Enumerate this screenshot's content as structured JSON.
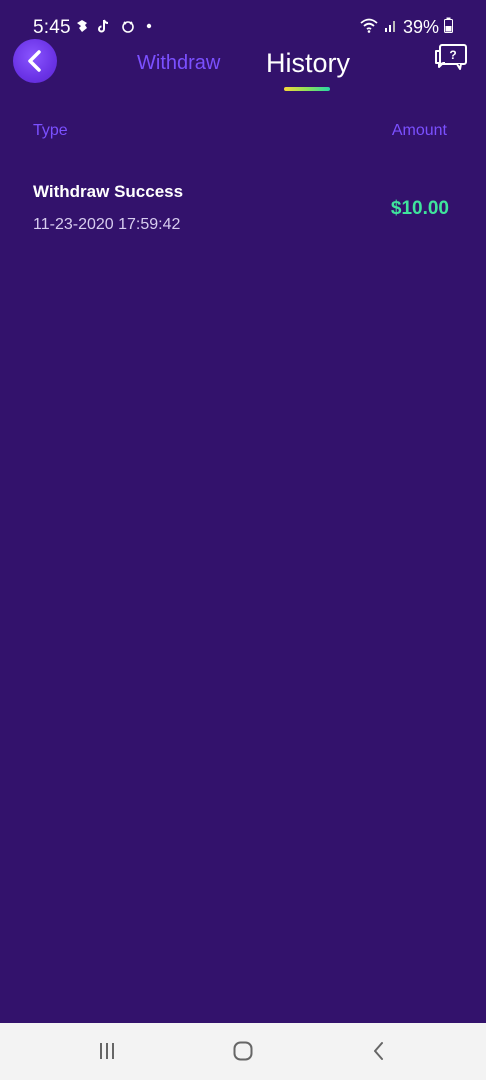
{
  "status_bar": {
    "time": "5:45",
    "battery": "39%",
    "notification_icons": [
      "messenger-icon",
      "tiktok-icon",
      "app-icon",
      "dot-icon"
    ]
  },
  "header": {
    "back_icon": "chevron-left-icon",
    "tabs": [
      {
        "label": "Withdraw",
        "active": false
      },
      {
        "label": "History",
        "active": true
      }
    ],
    "help_icon": "help-chat-icon"
  },
  "table": {
    "columns": {
      "type": "Type",
      "amount": "Amount"
    },
    "rows": [
      {
        "title": "Withdraw Success",
        "date": "11-23-2020 17:59:42",
        "amount": "$10.00"
      }
    ]
  },
  "nav_bar": {
    "buttons": [
      "recent-apps-icon",
      "home-icon",
      "back-icon"
    ]
  },
  "colors": {
    "background": "#33126c",
    "accent": "#7b50ff",
    "amount_green": "#3fe49c",
    "tab_active": "#ffffff"
  }
}
